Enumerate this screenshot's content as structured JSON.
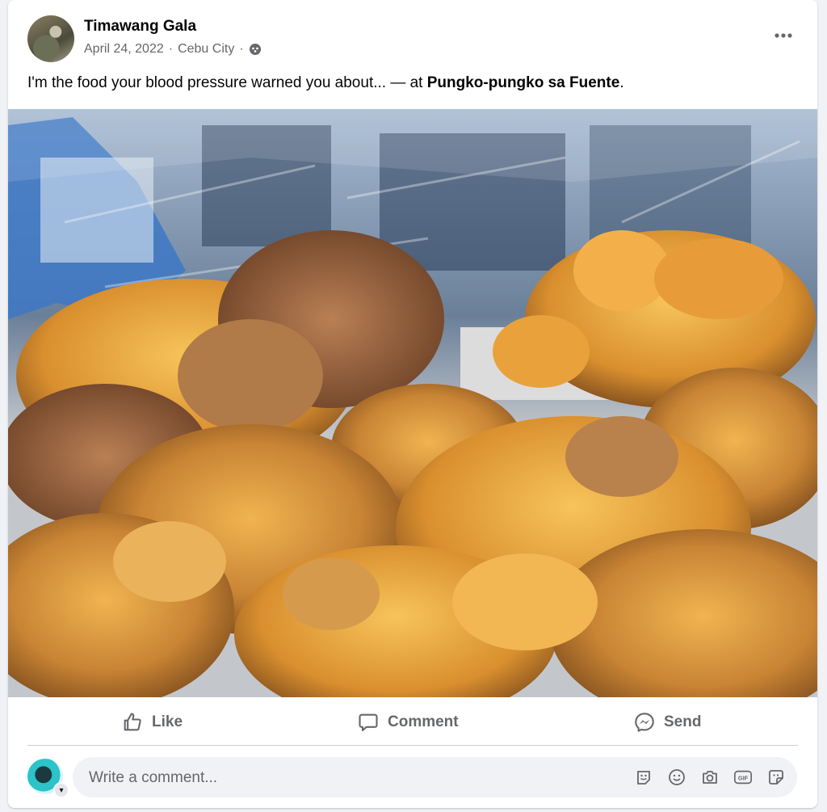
{
  "post": {
    "author": "Timawang Gala",
    "date": "April 24, 2022",
    "location": "Cebu City",
    "caption_prefix": "I'm the food your blood pressure warned you about... — at ",
    "caption_place": "Pungko-pungko sa Fuente",
    "caption_suffix": "."
  },
  "actions": {
    "like": "Like",
    "comment": "Comment",
    "send": "Send"
  },
  "comment_box": {
    "placeholder": "Write a comment..."
  },
  "icons": {
    "more": "more-options-icon",
    "privacy": "globe-icon",
    "like": "thumbs-up-icon",
    "comment": "speech-bubble-icon",
    "send": "messenger-icon",
    "sticker_avatar": "avatar-sticker-icon",
    "emoji": "smiley-icon",
    "camera": "camera-icon",
    "gif": "gif-icon",
    "sticker": "sticker-icon"
  },
  "colors": {
    "secondary_text": "#65676b",
    "card_bg": "#ffffff",
    "page_bg": "#f0f2f5"
  }
}
